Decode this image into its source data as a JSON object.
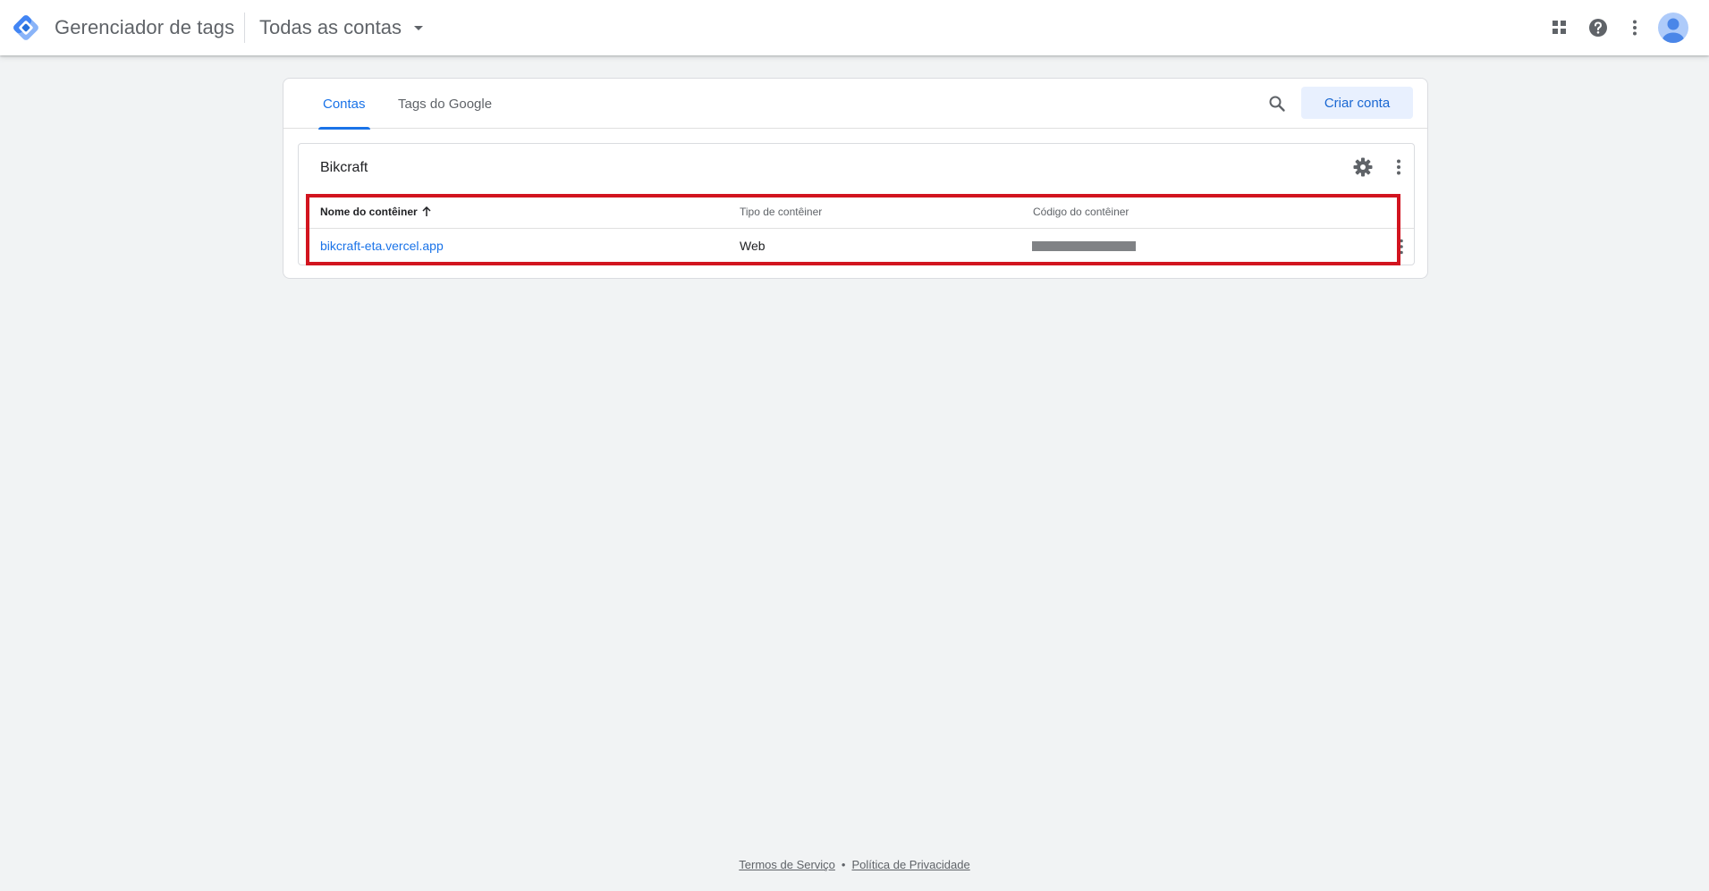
{
  "header": {
    "product_name": "Gerenciador de tags",
    "account_selector": "Todas as contas",
    "icons": [
      "apps-icon",
      "help-icon",
      "more-vert-icon",
      "account-avatar"
    ]
  },
  "card": {
    "tabs": [
      {
        "label": "Contas",
        "active": true
      },
      {
        "label": "Tags do Google",
        "active": false
      }
    ],
    "create_button": "Criar conta",
    "account": {
      "name": "Bikcraft",
      "columns": [
        "Nome do contêiner",
        "Tipo de contêiner",
        "Código do contêiner"
      ],
      "sort_column": "Nome do contêiner",
      "sort_direction": "ascending",
      "rows": [
        {
          "name": "bikcraft-eta.vercel.app",
          "type": "Web",
          "code": ""
        }
      ]
    }
  },
  "footer": {
    "terms": "Termos de Serviço",
    "separator": "•",
    "privacy": "Política de Privacidade"
  },
  "colors": {
    "accent": "#1a73e8",
    "highlight": "#d2141f",
    "background": "#f1f3f4"
  }
}
